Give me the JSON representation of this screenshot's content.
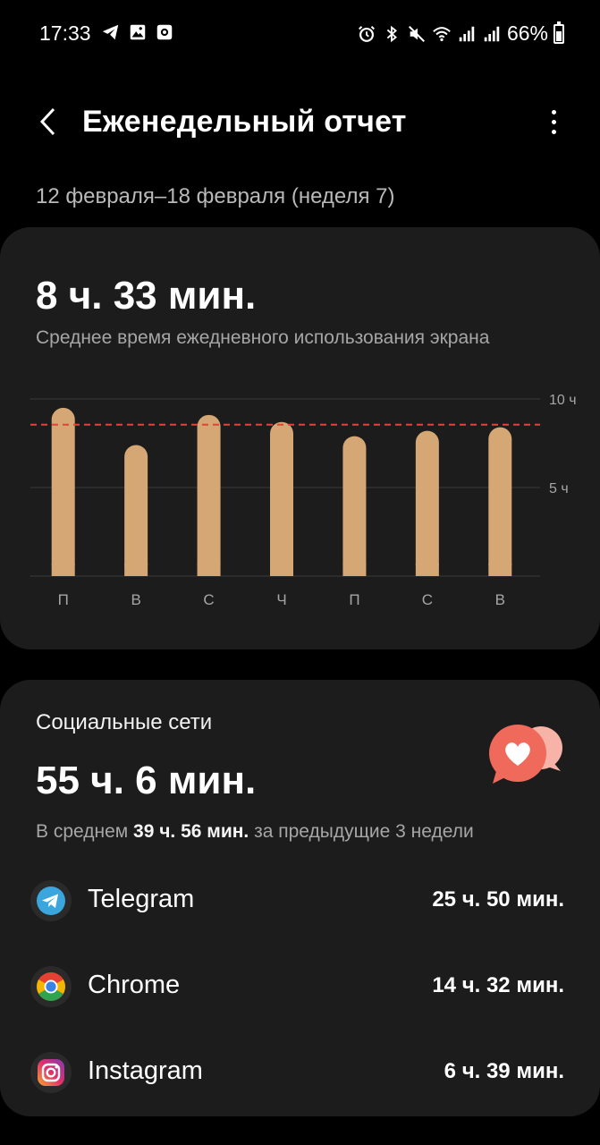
{
  "status_bar": {
    "time": "17:33",
    "battery": "66%",
    "battery_level": 0.66,
    "left_icons": [
      "telegram-icon",
      "gallery-icon",
      "screen-record-icon"
    ],
    "right_icons": [
      "alarm-icon",
      "bluetooth-icon",
      "mute-icon",
      "wifi-icon",
      "signal-icon",
      "signal-icon"
    ]
  },
  "header": {
    "title": "Еженедельный отчет"
  },
  "date_range": "12 февраля–18 февраля (неделя 7)",
  "summary": {
    "avg_time": "8 ч. 33 мин.",
    "avg_caption": "Среднее время ежедневного использования экрана"
  },
  "chart_data": {
    "type": "bar",
    "categories": [
      "П",
      "В",
      "С",
      "Ч",
      "П",
      "С",
      "В"
    ],
    "values": [
      9.5,
      7.4,
      9.1,
      8.7,
      7.9,
      8.2,
      8.4
    ],
    "average": 8.55,
    "ylim": [
      0,
      10
    ],
    "ytick_labels": [
      "10 ч",
      "5 ч"
    ],
    "ytick_values": [
      10,
      5
    ],
    "bar_color": "#d4a774",
    "average_line_color": "#e0453a",
    "grid": true
  },
  "category": {
    "title": "Социальные сети",
    "total": "55 ч. 6 мин.",
    "compare_prefix": "В среднем ",
    "compare_value": "39 ч. 56 мин.",
    "compare_suffix": " за предыдущие 3 недели",
    "icon": "heart-chat-icon",
    "accent": "#f26b5e"
  },
  "apps": [
    {
      "name": "Telegram",
      "time": "25 ч. 50 мин.",
      "icon": "telegram-icon"
    },
    {
      "name": "Chrome",
      "time": "14 ч. 32 мин.",
      "icon": "chrome-icon"
    },
    {
      "name": "Instagram",
      "time": "6 ч. 39 мин.",
      "icon": "instagram-icon"
    }
  ]
}
